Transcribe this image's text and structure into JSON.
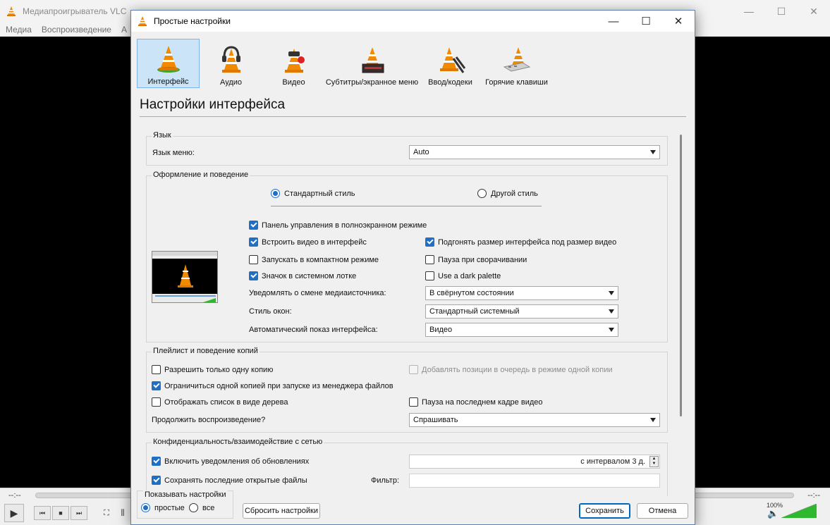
{
  "background": {
    "title": "Медиапроигрыватель VLC",
    "menu": [
      "Медиа",
      "Воспроизведение",
      "А"
    ],
    "time_left": "--:--",
    "time_right": "--:--",
    "volume": "100%",
    "window_buttons": [
      "—",
      "☐",
      "✕"
    ]
  },
  "dialog": {
    "title": "Простые настройки",
    "window_buttons": [
      "—",
      "☐",
      "✕"
    ],
    "categories": [
      {
        "label": "Интерфейс"
      },
      {
        "label": "Аудио"
      },
      {
        "label": "Видео"
      },
      {
        "label": "Субтитры/экранное меню"
      },
      {
        "label": "Ввод/кодеки"
      },
      {
        "label": "Горячие клавиши"
      }
    ],
    "selected_category": "Интерфейс",
    "section_title": "Настройки интерфейса",
    "language": {
      "group": "Язык",
      "menu_language_label": "Язык меню:",
      "menu_language_value": "Auto"
    },
    "appearance": {
      "group": "Оформление и поведение",
      "style_standard": "Стандартный стиль",
      "style_other": "Другой стиль",
      "fullscreen_controller": "Панель управления в полноэкранном режиме",
      "embed_video": "Встроить видео в интерфейс",
      "resize_to_video": "Подгонять размер интерфейса под размер видео",
      "start_minimal": "Запускать в компактном режиме",
      "pause_minimized": "Пауза при сворачивании",
      "systray_icon": "Значок в системном лотке",
      "dark_palette": "Use a dark palette",
      "notify_label": "Уведомлять о смене медиаисточника:",
      "notify_value": "В свёрнутом состоянии",
      "window_style_label": "Стиль окон:",
      "window_style_value": "Стандартный системный",
      "auto_raise_label": "Автоматический показ интерфейса:",
      "auto_raise_value": "Видео"
    },
    "playlist": {
      "group": "Плейлист и поведение копий",
      "one_instance": "Разрешить только одну копию",
      "enqueue_one_instance": "Добавлять позиции в очередь в режиме одной копии",
      "one_instance_file_manager": "Ограничиться одной копией при запуске из менеджера файлов",
      "tree_view": "Отображать список в виде дерева",
      "pause_last_frame": "Пауза на последнем кадре видео",
      "resume_label": "Продолжить воспроизведение?",
      "resume_value": "Спрашивать"
    },
    "privacy": {
      "group": "Конфиденциальность/взаимодействие с сетью",
      "update_notify": "Включить уведомления об обновлениях",
      "update_interval": "с интервалом 3 д.",
      "save_recent": "Сохранять последние открытые файлы",
      "filter_label": "Фильтр:",
      "filter_value": ""
    },
    "footer": {
      "show_settings_label": "Показывать настройки",
      "simple": "простые",
      "all": "все",
      "reset": "Сбросить настройки",
      "save": "Сохранить",
      "cancel": "Отмена"
    }
  },
  "colors": {
    "accent": "#1f6fc5",
    "selected_tab_bg": "#cce4f7",
    "vlc_orange": "#f18a00",
    "volume_green": "#2db82d"
  }
}
